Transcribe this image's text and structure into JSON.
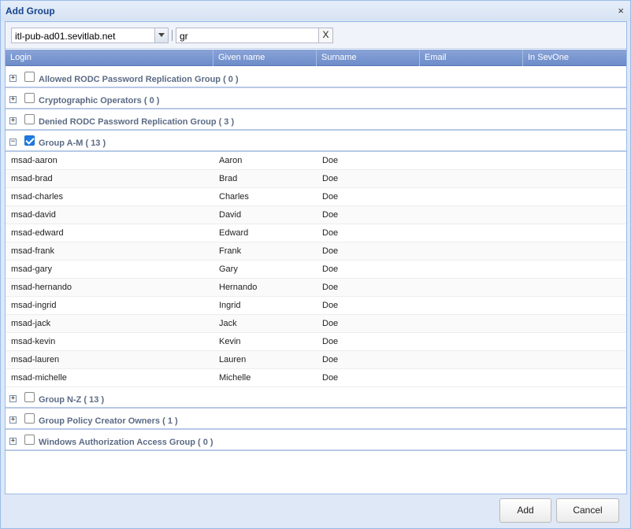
{
  "dialog": {
    "title": "Add Group",
    "close_symbol": "×"
  },
  "toolbar": {
    "domain_value": "itl-pub-ad01.sevitlab.net",
    "search_value": "gr",
    "clear_symbol": "X"
  },
  "columns": [
    "Login",
    "Given name",
    "Surname",
    "Email",
    "In SevOne"
  ],
  "groups_before": [
    {
      "label": "Allowed RODC Password Replication Group ( 0 )",
      "expanded": false,
      "checked": false
    },
    {
      "label": "Cryptographic Operators ( 0 )",
      "expanded": false,
      "checked": false
    },
    {
      "label": "Denied RODC Password Replication Group ( 3 )",
      "expanded": false,
      "checked": false
    }
  ],
  "expanded_group": {
    "label": "Group A-M ( 13 )",
    "expanded": true,
    "checked": true
  },
  "members": [
    {
      "login": "msad-aaron",
      "given": "Aaron",
      "surname": "Doe"
    },
    {
      "login": "msad-brad",
      "given": "Brad",
      "surname": "Doe"
    },
    {
      "login": "msad-charles",
      "given": "Charles",
      "surname": "Doe"
    },
    {
      "login": "msad-david",
      "given": "David",
      "surname": "Doe"
    },
    {
      "login": "msad-edward",
      "given": "Edward",
      "surname": "Doe"
    },
    {
      "login": "msad-frank",
      "given": "Frank",
      "surname": "Doe"
    },
    {
      "login": "msad-gary",
      "given": "Gary",
      "surname": "Doe"
    },
    {
      "login": "msad-hernando",
      "given": "Hernando",
      "surname": "Doe"
    },
    {
      "login": "msad-ingrid",
      "given": "Ingrid",
      "surname": "Doe"
    },
    {
      "login": "msad-jack",
      "given": "Jack",
      "surname": "Doe"
    },
    {
      "login": "msad-kevin",
      "given": "Kevin",
      "surname": "Doe"
    },
    {
      "login": "msad-lauren",
      "given": "Lauren",
      "surname": "Doe"
    },
    {
      "login": "msad-michelle",
      "given": "Michelle",
      "surname": "Doe"
    }
  ],
  "groups_after": [
    {
      "label": "Group N-Z ( 13 )",
      "expanded": false,
      "checked": false
    },
    {
      "label": "Group Policy Creator Owners ( 1 )",
      "expanded": false,
      "checked": false
    },
    {
      "label": "Windows Authorization Access Group ( 0 )",
      "expanded": false,
      "checked": false
    }
  ],
  "footer": {
    "add_label": "Add",
    "cancel_label": "Cancel"
  },
  "colors": {
    "header": "#6c8cc9",
    "group_text": "#5b6b85",
    "checkbox": "#1e7be0"
  }
}
